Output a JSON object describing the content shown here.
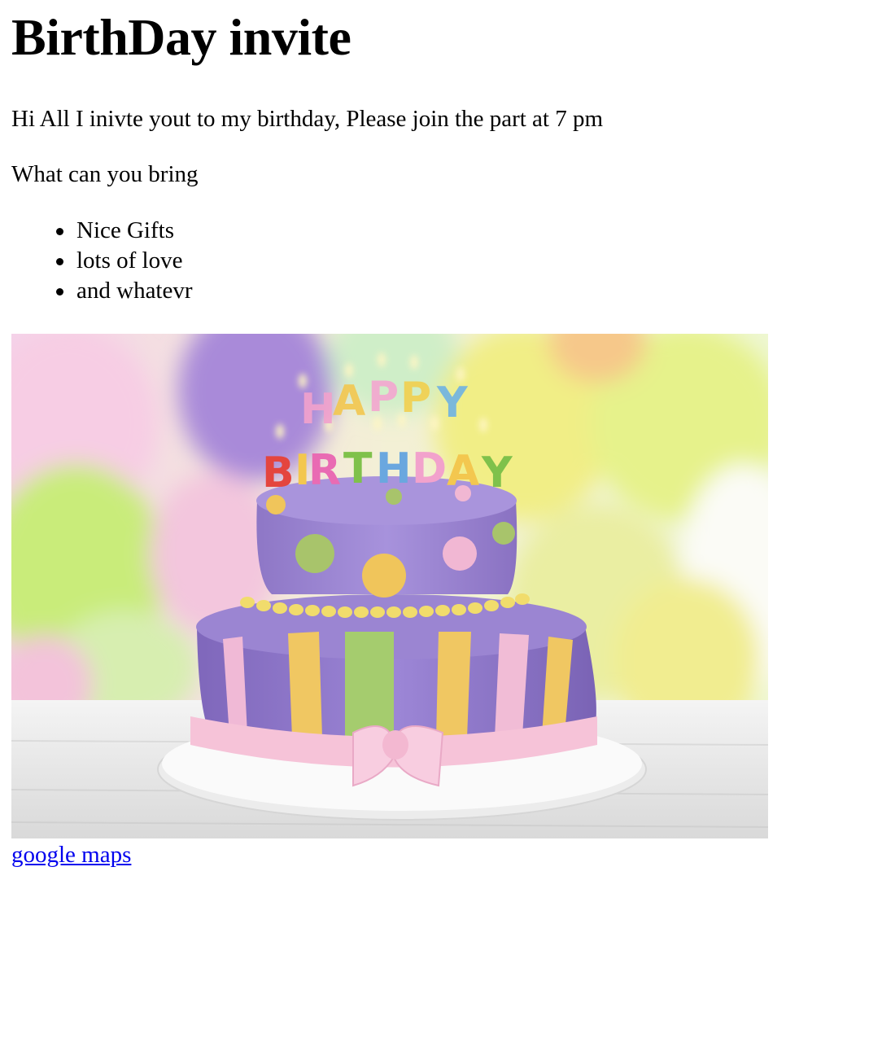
{
  "page": {
    "heading": "BirthDay invite",
    "invite_text": "Hi All I inivte yout to my birthday, Please join the part at 7 pm",
    "bring_prompt": "What can you bring",
    "bring_items": [
      "Nice Gifts",
      "lots of love",
      "and whatevr"
    ],
    "image": {
      "label": "birthday-cake-photo",
      "candle_letters_top": "HAPPY",
      "candle_letters_bottom": "BIRTHDAY"
    },
    "link_text": "google maps"
  },
  "colors": {
    "link": "#0000ee",
    "text": "#000000",
    "background": "#ffffff"
  }
}
